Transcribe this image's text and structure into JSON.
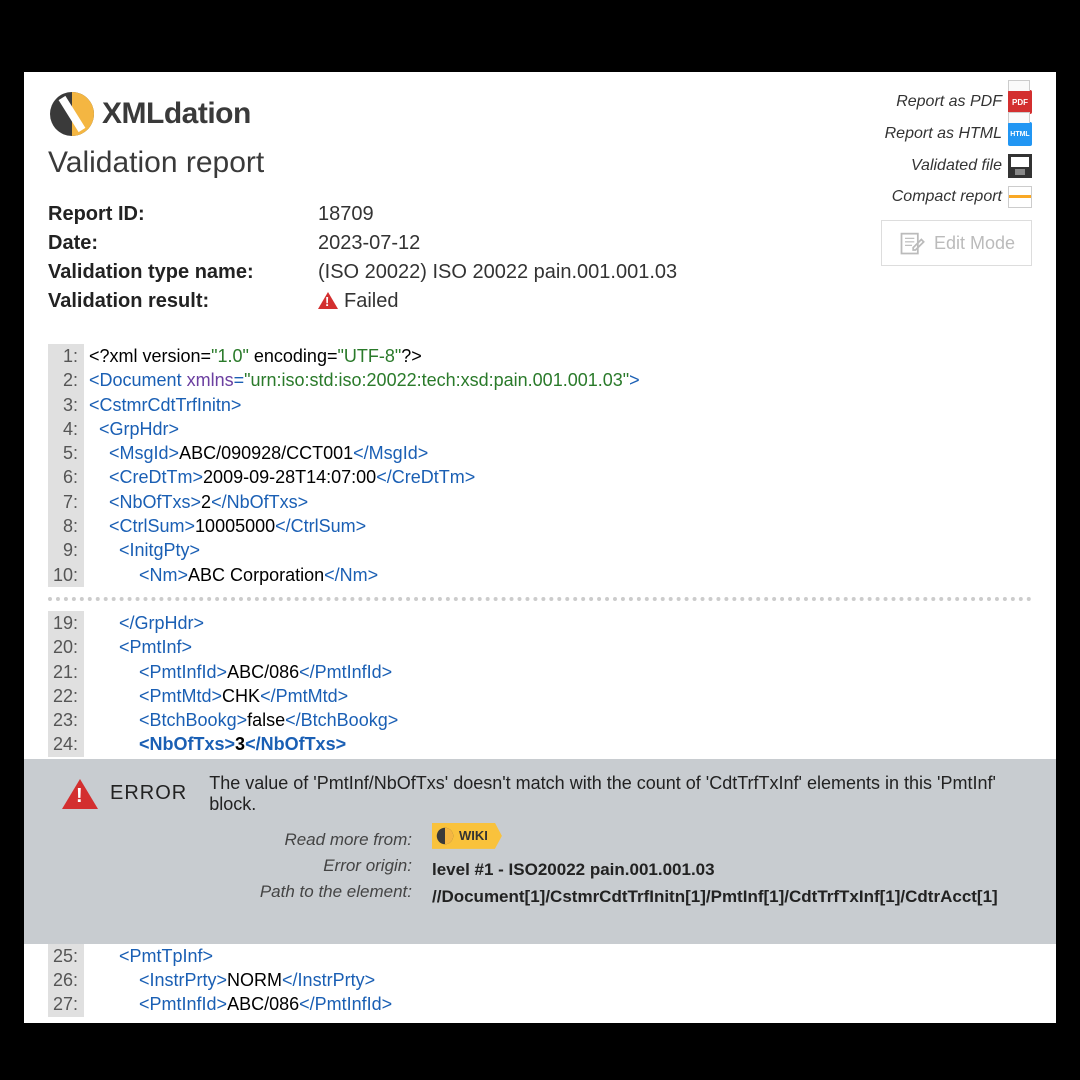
{
  "brand": "XMLdation",
  "title": "Validation report",
  "actions": {
    "pdf": "Report as PDF",
    "html": "Report as HTML",
    "validated": "Validated file",
    "compact": "Compact report",
    "edit_mode": "Edit Mode"
  },
  "meta": {
    "report_id_label": "Report ID:",
    "report_id_value": "18709",
    "date_label": "Date:",
    "date_value": "2023-07-12",
    "type_label": "Validation type name:",
    "type_value": "(ISO 20022) ISO 20022 pain.001.001.03",
    "result_label": "Validation result:",
    "result_value": "Failed"
  },
  "xml": {
    "lines_a": [
      {
        "n": "1",
        "html": "<span class='txt'>&lt;?xml version=</span><span class='val'>\"1.0\"</span><span class='txt'> encoding=</span><span class='val'>\"UTF-8\"</span><span class='txt'>?&gt;</span>"
      },
      {
        "n": "2",
        "html": "<span class='tag'>&lt;Document </span><span class='attr'>xmlns</span><span class='tag'>=</span><span class='val'>\"urn:iso:std:iso:20022:tech:xsd:pain.001.001.03\"</span><span class='tag'>&gt;</span>"
      },
      {
        "n": "3",
        "html": "<span class='tag'>&lt;CstmrCdtTrfInitn&gt;</span>"
      },
      {
        "n": "4",
        "html": "  <span class='tag'>&lt;GrpHdr&gt;</span>"
      },
      {
        "n": "5",
        "html": "    <span class='tag'>&lt;MsgId&gt;</span><span class='txt'>ABC/090928/CCT001</span><span class='tag'>&lt;/MsgId&gt;</span>"
      },
      {
        "n": "6",
        "html": "    <span class='tag'>&lt;CreDtTm&gt;</span><span class='txt'>2009-09-28T14:07:00</span><span class='tag'>&lt;/CreDtTm&gt;</span>"
      },
      {
        "n": "7",
        "html": "    <span class='tag'>&lt;NbOfTxs&gt;</span><span class='txt'>2</span><span class='tag'>&lt;/NbOfTxs&gt;</span>"
      },
      {
        "n": "8",
        "html": "    <span class='tag'>&lt;CtrlSum&gt;</span><span class='txt'>10005000</span><span class='tag'>&lt;/CtrlSum&gt;</span>"
      },
      {
        "n": "9",
        "html": "      <span class='tag'>&lt;InitgPty&gt;</span>"
      },
      {
        "n": "10",
        "html": "          <span class='tag'>&lt;Nm&gt;</span><span class='txt'>ABC Corporation</span><span class='tag'>&lt;/Nm&gt;</span>"
      }
    ],
    "lines_b": [
      {
        "n": "19",
        "html": "      <span class='tag'>&lt;/GrpHdr&gt;</span>"
      },
      {
        "n": "20",
        "html": "      <span class='tag'>&lt;PmtInf&gt;</span>"
      },
      {
        "n": "21",
        "html": "          <span class='tag'>&lt;PmtInfId&gt;</span><span class='txt'>ABC/086</span><span class='tag'>&lt;/PmtInfId&gt;</span>"
      },
      {
        "n": "22",
        "html": "          <span class='tag'>&lt;PmtMtd&gt;</span><span class='txt'>CHK</span><span class='tag'>&lt;/PmtMtd&gt;</span>"
      },
      {
        "n": "23",
        "html": "          <span class='tag'>&lt;BtchBookg&gt;</span><span class='txt'>false</span><span class='tag'>&lt;/BtchBookg&gt;</span>"
      },
      {
        "n": "24",
        "html": "          <span class='tag'>&lt;NbOfTxs&gt;</span><span class='txt'>3</span><span class='tag'>&lt;/NbOfTxs&gt;</span>",
        "bold": true
      }
    ],
    "lines_c": [
      {
        "n": "25",
        "html": "      <span class='tag'>&lt;PmtTpInf&gt;</span>"
      },
      {
        "n": "26",
        "html": "          <span class='tag'>&lt;InstrPrty&gt;</span><span class='txt'>NORM</span><span class='tag'>&lt;/InstrPrty&gt;</span>"
      },
      {
        "n": "27",
        "html": "          <span class='tag'>&lt;PmtInfId&gt;</span><span class='txt'>ABC/086</span><span class='tag'>&lt;/PmtInfId&gt;</span>"
      }
    ]
  },
  "error": {
    "label": "ERROR",
    "message": "The value of 'PmtInf/NbOfTxs' doesn't match with the count of 'CdtTrfTxInf' elements in this 'PmtInf' block.",
    "read_more_label": "Read more from:",
    "wiki": "WIKI",
    "origin_label": "Error origin:",
    "origin_value": "level #1 - ISO20022 pain.001.001.03",
    "path_label": "Path to the element:",
    "path_value": "//Document[1]/CstmrCdtTrfInitn[1]/PmtInf[1]/CdtTrfTxInf[1]/CdtrAcct[1]"
  }
}
